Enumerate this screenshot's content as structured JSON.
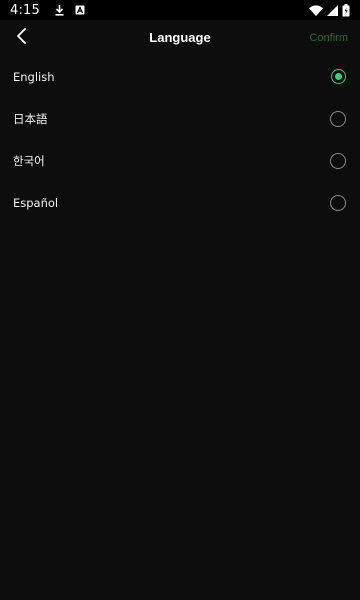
{
  "status_bar": {
    "time": "4:15",
    "icons": [
      "download-icon",
      "app-notification-icon",
      "wifi-icon",
      "signal-icon",
      "battery-icon"
    ]
  },
  "header": {
    "title": "Language",
    "back_icon": "chevron-left-icon",
    "confirm_label": "Confirm"
  },
  "colors": {
    "background": "#0d0d0d",
    "accent": "#2fd17a",
    "confirm_disabled": "#1f6b3d"
  },
  "languages": [
    {
      "label": "English",
      "selected": true
    },
    {
      "label": "日本語",
      "selected": false
    },
    {
      "label": "한국어",
      "selected": false
    },
    {
      "label": "Español",
      "selected": false
    }
  ]
}
